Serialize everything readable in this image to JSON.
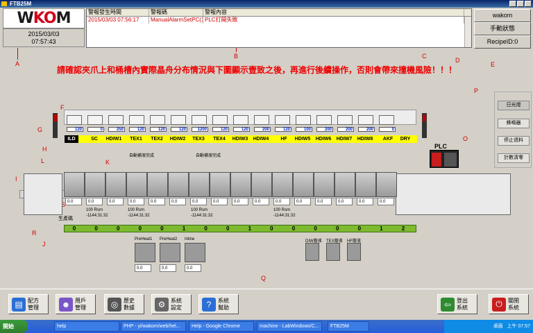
{
  "window": {
    "title": "FTB25M"
  },
  "logo": {
    "text_main": "W",
    "text_accent": "KO",
    "text_end": "M"
  },
  "datetime": {
    "date": "2015/03/03",
    "time": "07:57:43"
  },
  "alarm_table": {
    "headers": [
      "警報發生時間",
      "警報碼",
      "警報內容"
    ],
    "rows": [
      [
        "2015/03/03 07:56:17",
        "ManualAlarmSetPC(1)",
        "PLC打開失敗"
      ]
    ]
  },
  "right_header": {
    "user": "wakom",
    "mode": "手動狀態",
    "recipe": "RecipeID:0"
  },
  "warning_text": "請確認夾爪上和桶槽內實際晶舟分布情況與下圖顯示壹致之後，再進行後續操作，否則會帶來撞機風險！！！",
  "callouts": [
    "A",
    "B",
    "C",
    "D",
    "E",
    "F",
    "G",
    "H",
    "I",
    "J",
    "K",
    "L",
    "M",
    "O",
    "P",
    "Q",
    "R",
    "S"
  ],
  "side_buttons": [
    "日光燈",
    "蜂鳴器",
    "停止退料",
    "計數清零"
  ],
  "plc_label": "PLC",
  "tank_labels": [
    "ILD",
    "SC",
    "HDIW1",
    "TEX1",
    "TEX2",
    "HDIW2",
    "TEX3",
    "TEX4",
    "HDIW3",
    "HDIW4",
    "HF",
    "HDIW5",
    "HDIW6",
    "HDIW7",
    "HDIW8",
    "AKF",
    "DRY"
  ],
  "tank_values": [
    "120",
    "0",
    "250",
    "120",
    "120",
    "120",
    "1200",
    "120",
    "120",
    "200",
    "120",
    "100",
    "200",
    "200",
    "200",
    "0"
  ],
  "auto_labels": [
    "自動補液完成",
    "自動補液完成"
  ],
  "run_info": [
    {
      "rpm": "100 Rsm",
      "pos": "-1144:31:32"
    },
    {
      "rpm": "100 Rsm",
      "pos": "-1144:31:32"
    },
    {
      "rpm": "100 Rsm",
      "pos": "-1144:31:32"
    },
    {
      "rpm": "100 Rsm",
      "pos": "-1144:31:32"
    }
  ],
  "produce_label": "生產碼",
  "flow_values": [
    "0",
    "0",
    "0",
    "0",
    "0",
    "1",
    "0",
    "0",
    "1",
    "0",
    "0",
    "0",
    "0",
    "0",
    "1",
    "2"
  ],
  "heaters": [
    {
      "name": "PreHeat1",
      "value": "0.0"
    },
    {
      "name": "PreHeat2",
      "value": "0.0"
    },
    {
      "name": "Inline",
      "value": "0.0"
    }
  ],
  "waste": [
    "DIW廢液",
    "TEX廢液",
    "HF廢液"
  ],
  "small_values": [
    "0.0",
    "0.0",
    "0.0",
    "0.0",
    "0.0",
    "0.0"
  ],
  "bottom_buttons": [
    {
      "label1": "配方",
      "label2": "管理",
      "color": "#2b6fd6",
      "glyph": "▤"
    },
    {
      "label1": "用戶",
      "label2": "管理",
      "color": "#7a55c8",
      "glyph": "☻"
    },
    {
      "label1": "歷史",
      "label2": "數據",
      "color": "#555555",
      "glyph": "◎"
    },
    {
      "label1": "系統",
      "label2": "設定",
      "color": "#666666",
      "glyph": "⚙"
    },
    {
      "label1": "系統",
      "label2": "幫助",
      "color": "#2b6fd6",
      "glyph": "?"
    }
  ],
  "logout": {
    "label1": "登出",
    "label2": "系統",
    "color": "#2e8b2e",
    "glyph": "⇦"
  },
  "shutdown": {
    "label1": "關閉",
    "label2": "系統",
    "color": "#c81e1e",
    "glyph": "⏻"
  },
  "taskbar": {
    "start": "開始",
    "tasks": [
      "help",
      "PHP - yi/wakom/web/hel...",
      "Help - Google Chrome",
      "machine - LabWindows/C...",
      "FTB25M"
    ],
    "tray_text": "桌面",
    "clock": "上午 07:57"
  }
}
